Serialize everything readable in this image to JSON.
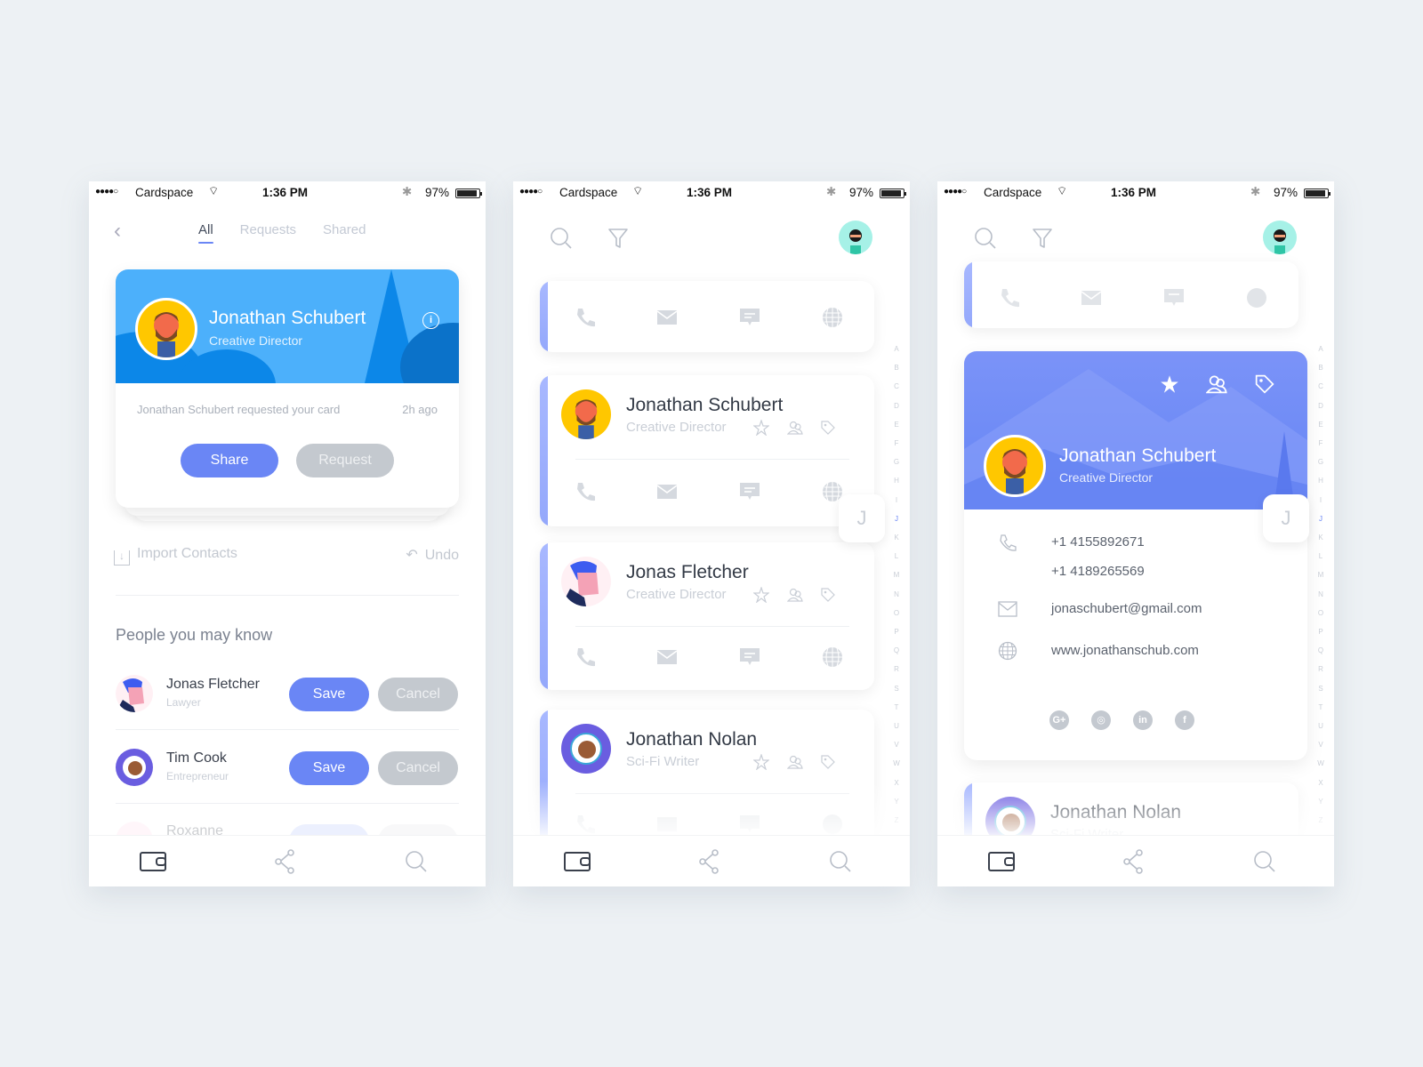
{
  "status_bar": {
    "signal": "●●●●○",
    "carrier": "Cardspace",
    "time": "1:36 PM",
    "battery": "97%"
  },
  "screen1": {
    "tabs": [
      {
        "label": "All",
        "active": true
      },
      {
        "label": "Requests",
        "active": false
      },
      {
        "label": "Shared",
        "active": false
      }
    ],
    "request_card": {
      "name": "Jonathan Schubert",
      "title": "Creative Director",
      "message": "Jonathan Schubert requested your card",
      "time": "2h ago",
      "share_label": "Share",
      "request_label": "Request"
    },
    "import_label": "Import Contacts",
    "undo_label": "Undo",
    "section_title": "People you may know",
    "people": [
      {
        "name": "Jonas Fletcher",
        "role": "Lawyer",
        "save_label": "Save",
        "cancel_label": "Cancel"
      },
      {
        "name": "Tim Cook",
        "role": "Entrepreneur",
        "save_label": "Save",
        "cancel_label": "Cancel"
      },
      {
        "name": "Roxanne",
        "role": "",
        "save_label": "",
        "cancel_label": ""
      }
    ]
  },
  "screen2": {
    "contacts": [
      {
        "name": "Jonathan Schubert",
        "title": "Creative Director"
      },
      {
        "name": "Jonas Fletcher",
        "title": "Creative Director"
      },
      {
        "name": "Jonathan Nolan",
        "title": "Sci-Fi Writer"
      }
    ],
    "index_letters": [
      "A",
      "B",
      "C",
      "D",
      "E",
      "F",
      "G",
      "H",
      "I",
      "J",
      "K",
      "L",
      "M",
      "N",
      "O",
      "P",
      "Q",
      "R",
      "S",
      "T",
      "U",
      "V",
      "W",
      "X",
      "Y",
      "Z"
    ],
    "active_letter": "J",
    "bubble_letter": "J"
  },
  "screen3": {
    "detail": {
      "name": "Jonathan Schubert",
      "title": "Creative Director",
      "phone1": "+1 4155892671",
      "phone2": "+1 4189265569",
      "email": "jonaschubert@gmail.com",
      "website": "www.jonathanschub.com",
      "socials": [
        "G+",
        "instagram",
        "in",
        "f"
      ]
    },
    "next_contact": {
      "name": "Jonathan Nolan",
      "title": "Sci-Fi Writer"
    },
    "bubble_letter": "J"
  },
  "colors": {
    "accent": "#6a86f5",
    "request_blue": "#4cb0fb",
    "muted": "#c4c9cf"
  }
}
